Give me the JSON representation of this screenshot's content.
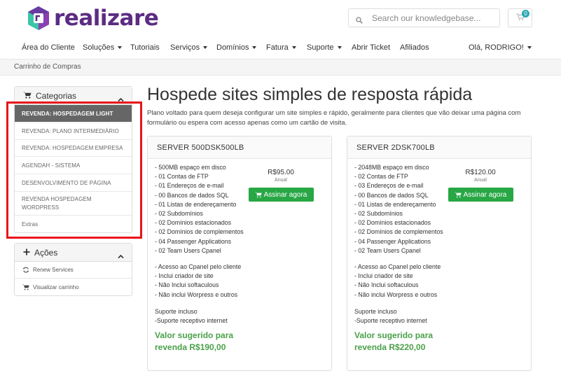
{
  "brand": {
    "name": "realizare",
    "color": "#5b2c83",
    "accent": "#2ba8b5"
  },
  "search": {
    "placeholder": "Search our knowledgebase..."
  },
  "cart": {
    "count": "0"
  },
  "nav": {
    "items": [
      {
        "label": "Área do Cliente",
        "dropdown": false
      },
      {
        "label": "Soluções",
        "dropdown": true
      },
      {
        "label": "Tutoriais",
        "dropdown": false
      },
      {
        "label": "Serviços",
        "dropdown": true
      },
      {
        "label": "Domínios",
        "dropdown": true
      },
      {
        "label": "Fatura",
        "dropdown": true
      },
      {
        "label": "Suporte",
        "dropdown": true
      },
      {
        "label": "Abrir Ticket",
        "dropdown": false
      },
      {
        "label": "Afiliados",
        "dropdown": false
      }
    ],
    "user": "Olá, RODRIGO!"
  },
  "breadcrumb": "Carrinho de Compras",
  "categories": {
    "title": "Categorias",
    "items": [
      {
        "label": "REVENDA: HOSPEDAGEM LIGHT",
        "active": true
      },
      {
        "label": "REVENDA: PLANO INTERMEDIÁRIO",
        "active": false
      },
      {
        "label": "REVENDA: HOSPEDAGEM EMPRESA",
        "active": false
      },
      {
        "label": "AGENDAH - SISTEMA",
        "active": false
      },
      {
        "label": "DESENVOLVIMENTO DE PÁGINA",
        "active": false
      },
      {
        "label": "REVENDA HOSPEDAGEM WORDPRESS",
        "active": false
      },
      {
        "label": "Extras",
        "active": false
      }
    ]
  },
  "actions": {
    "title": "Ações",
    "items": [
      {
        "label": "Renew Services",
        "icon": "refresh-icon"
      },
      {
        "label": "Visualizar carrinho",
        "icon": "cart-icon"
      }
    ]
  },
  "main": {
    "title": "Hospede sites simples de resposta rápida",
    "description": "Plano voltado para quem deseja configurar um site simples e rápido, geralmente para clientes que vão deixar uma página com formulário ou espera com acesso apenas como um cartão de visita."
  },
  "products": [
    {
      "name": "SERVER 500DSK500LB",
      "price": "R$95.00",
      "cycle": "Anual",
      "order_label": "Assinar agora",
      "features": [
        "- 500MB espaço em disco",
        "- 01 Contas de FTP",
        "- 01 Endereços de e-mail",
        "- 00 Bancos de dados SQL",
        "- 01 Listas de endereçamento",
        "- 02 Subdomínios",
        "- 02 Domínios estacionados",
        "- 02 Domínios de complementos",
        "- 04 Passenger Applications",
        "- 02 Team Users Cpanel",
        "",
        "- Acesso ao Cpanel pelo cliente",
        "- Inclui criador de site",
        "- Não Inclui softaculous",
        "- Não inclui Worpress e outros",
        "",
        "Suporte incluso",
        "-Suporte receptivo internet"
      ],
      "suggest_line1": "Valor sugerido para",
      "suggest_line2": "revenda R$190,00"
    },
    {
      "name": "SERVER 2DSK700LB",
      "price": "R$120.00",
      "cycle": "Anual",
      "order_label": "Assinar agora",
      "features": [
        "- 2048MB espaço em disco",
        "- 02 Contas de FTP",
        "- 03 Endereços de e-mail",
        "- 00 Bancos de dados SQL",
        "- 01 Listas de endereçamento",
        "- 02 Subdomínios",
        "- 02 Domínios estacionados",
        "- 02 Domínios de complementos",
        "- 04 Passenger Applications",
        "- 02 Team Users Cpanel",
        "",
        "- Acesso ao Cpanel pelo cliente",
        "- Inclui criador de site",
        "- Não Inclui softaculous",
        "- Não inclui Worpress e outros",
        "",
        "Suporte incluso",
        "-Suporte receptivo internet"
      ],
      "suggest_line1": "Valor sugerido para",
      "suggest_line2": "revenda R$220,00"
    }
  ]
}
